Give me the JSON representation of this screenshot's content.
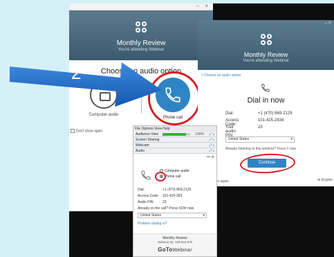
{
  "colors": {
    "accent": "#2f84c3",
    "annotation_red": "#d32027",
    "arrow_blue": "#1e6fc8",
    "background": "#d5f0f7"
  },
  "annotation": {
    "step_number": "2"
  },
  "back_window": {
    "title": "Monthly Review",
    "subtitle": "You're attending Webinar",
    "prompt": "Choose an audio option",
    "computer_audio_label": "Computer audio",
    "phone_call_label": "Phone call",
    "dont_show_again": "Don't show again",
    "window_controls": "– ×"
  },
  "front_window": {
    "title": "Monthly Review",
    "subtitle": "You're attending Webinar",
    "window_controls": "– ×",
    "back_link": "< Choose an audio option",
    "heading": "Dial in now",
    "dial_label": "Dial:",
    "dial_value": "+1 (470) 869-2129",
    "access_code_label": "Access Code:",
    "access_code_value": "101-425-2834",
    "audio_pin_label": "Your audio PIN:",
    "audio_pin_value": "23",
    "country_select": "United States",
    "already_text": "Already listening to this webinar? Press # now",
    "continue_button": "Continue",
    "footer_left": "ws again",
    "footer_right": "English"
  },
  "panel": {
    "menubar": "File  Options  View  Help",
    "rows": {
      "audience_view": "Audience View",
      "audience_view_pct": "100%",
      "screen_sharing": "Screen Sharing",
      "webcam": "Webcam",
      "audio": "Audio"
    },
    "audio_level": 0.85,
    "computer_audio": "Computer audio",
    "phone_call": "Phone call",
    "dial_label": "Dial:",
    "dial_value": "+1 (470) 869-2129",
    "access_code_label": "Access Code:",
    "access_code_value": "101-425-283",
    "audio_pin_label": "Audio PIN:",
    "audio_pin_value": "23",
    "already_text": "Already on the call? Press #23# now.",
    "country_select": "United States",
    "link_text": "Problem dialing in?",
    "footer_title": "Monthly Review",
    "footer_id": "Webinar ID: 765-944-875",
    "brand_bold": "GoTo",
    "brand_light": "Webinar"
  }
}
